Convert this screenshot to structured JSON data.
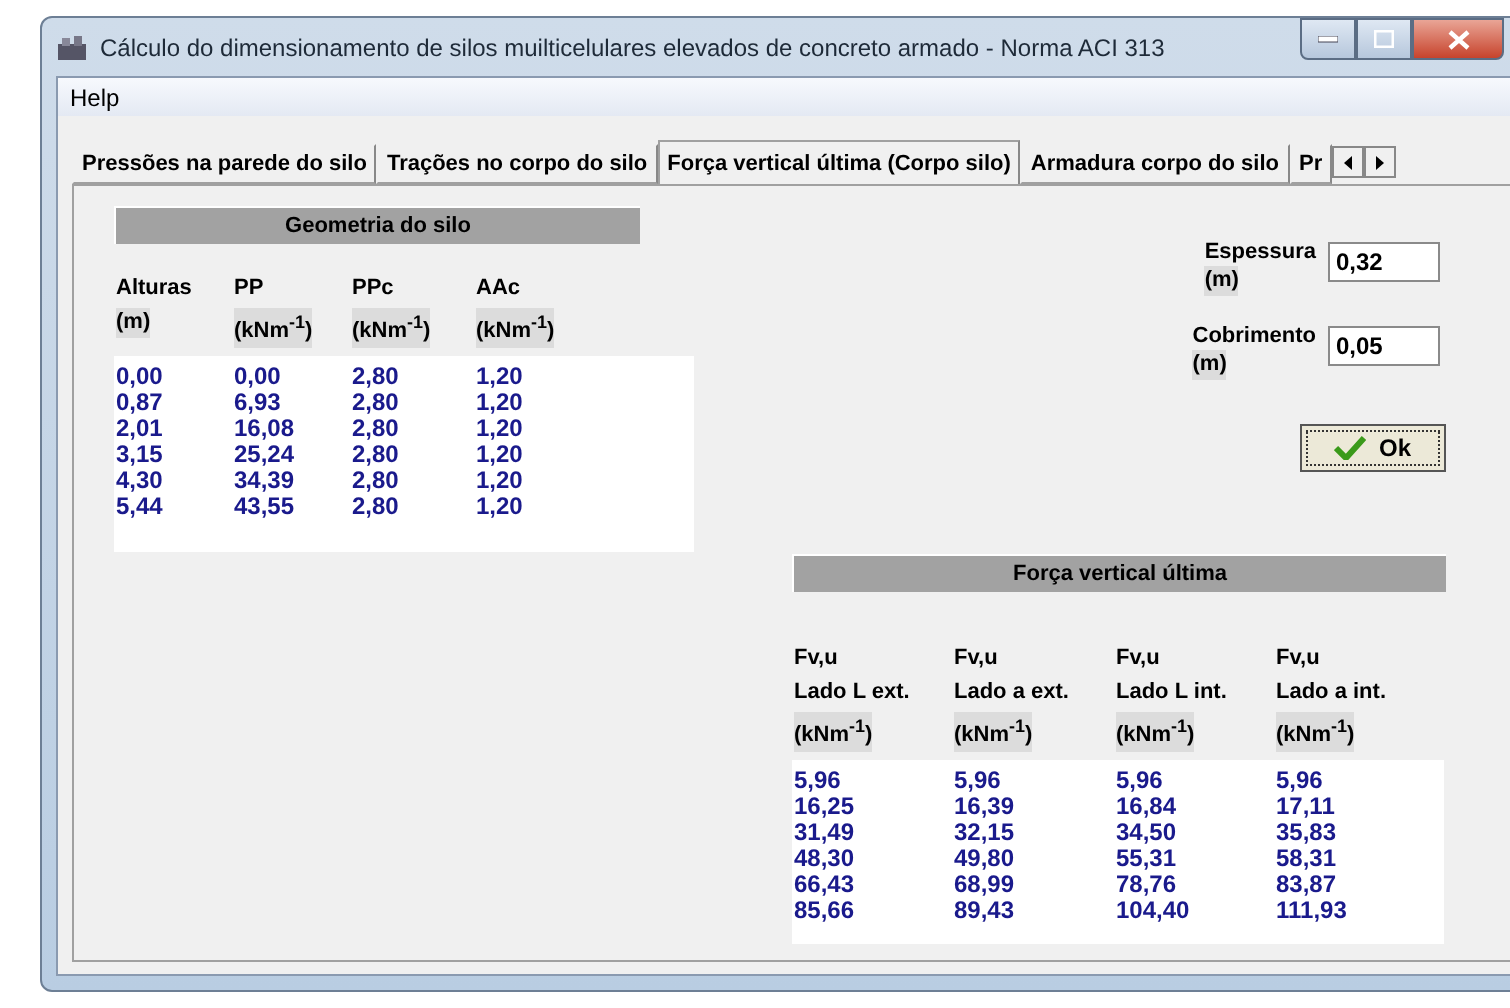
{
  "window": {
    "title": "Cálculo do dimensionamento de silos muilticelulares elevados de concreto armado - Norma ACI 313"
  },
  "menu": [
    "Help"
  ],
  "tabs": [
    {
      "label": "Pressões na parede do silo",
      "selected": false
    },
    {
      "label": "Trações no corpo do silo",
      "selected": false
    },
    {
      "label": "Força vertical última (Corpo silo)",
      "selected": true
    },
    {
      "label": "Armadura corpo do silo",
      "selected": false
    },
    {
      "label": "Pr",
      "selected": false
    }
  ],
  "geometry": {
    "title": "Geometria do silo",
    "columns": [
      {
        "name": [
          "Alturas"
        ],
        "unit": "(m)"
      },
      {
        "name": [
          "PP"
        ],
        "unit": "(kNm$^{-1}$)"
      },
      {
        "name": [
          "PPc"
        ],
        "unit": "(kNm$^{-1}$)"
      },
      {
        "name": [
          "AAc"
        ],
        "unit": "(kNm$^{-1}$)"
      }
    ],
    "rows": [
      [
        "0,00",
        "0,00",
        "2,80",
        "1,20"
      ],
      [
        "0,87",
        "6,93",
        "2,80",
        "1,20"
      ],
      [
        "2,01",
        "16,08",
        "2,80",
        "1,20"
      ],
      [
        "3,15",
        "25,24",
        "2,80",
        "1,20"
      ],
      [
        "4,30",
        "34,39",
        "2,80",
        "1,20"
      ],
      [
        "5,44",
        "43,55",
        "2,80",
        "1,20"
      ]
    ]
  },
  "inputs": [
    {
      "label": "Espessura",
      "unit": "(m)",
      "value": "0,32"
    },
    {
      "label": "Cobrimento",
      "unit": "(m)",
      "value": "0,05"
    }
  ],
  "ok_button": {
    "label": "Ok"
  },
  "force": {
    "title": "Força vertical última",
    "columns": [
      {
        "name": [
          "Fv,u",
          "Lado L ext."
        ],
        "unit": "(kNm$^{-1}$)"
      },
      {
        "name": [
          "Fv,u",
          "Lado a ext."
        ],
        "unit": "(kNm$^{-1}$)"
      },
      {
        "name": [
          "Fv,u",
          "Lado L int."
        ],
        "unit": "(kNm$^{-1}$)"
      },
      {
        "name": [
          "Fv,u",
          "Lado a int."
        ],
        "unit": "(kNm$^{-1}$)"
      }
    ],
    "rows": [
      [
        "5,96",
        "5,96",
        "5,96",
        "5,96"
      ],
      [
        "16,25",
        "16,39",
        "16,84",
        "17,11"
      ],
      [
        "31,49",
        "32,15",
        "34,50",
        "35,83"
      ],
      [
        "48,30",
        "49,80",
        "55,31",
        "58,31"
      ],
      [
        "66,43",
        "68,99",
        "78,76",
        "83,87"
      ],
      [
        "85,66",
        "89,43",
        "104,40",
        "111,93"
      ]
    ]
  }
}
